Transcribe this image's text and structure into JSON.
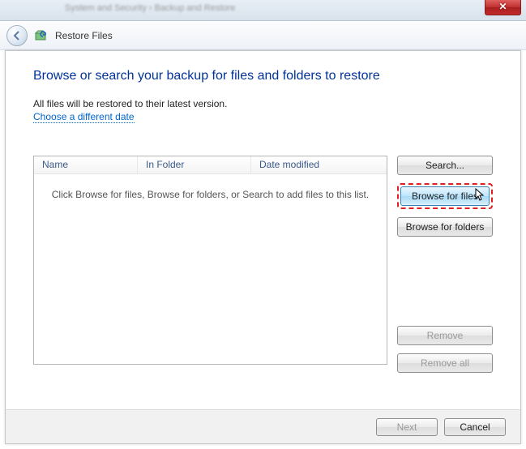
{
  "chrome": {
    "breadcrumb_blur": "System and Security  ›  Backup and Restore",
    "close_label": "✕"
  },
  "header": {
    "title": "Restore Files"
  },
  "page": {
    "title": "Browse or search your backup for files and folders to restore",
    "subtext": "All files will be restored to their latest version.",
    "link": "Choose a different date"
  },
  "list": {
    "col_name": "Name",
    "col_folder": "In Folder",
    "col_date": "Date modified",
    "empty": "Click Browse for files, Browse for folders, or Search to add files to this list."
  },
  "buttons": {
    "search": "Search...",
    "browse_files": "Browse for files",
    "browse_folders": "Browse for folders",
    "remove": "Remove",
    "remove_all": "Remove all"
  },
  "footer": {
    "next": "Next",
    "cancel": "Cancel"
  }
}
